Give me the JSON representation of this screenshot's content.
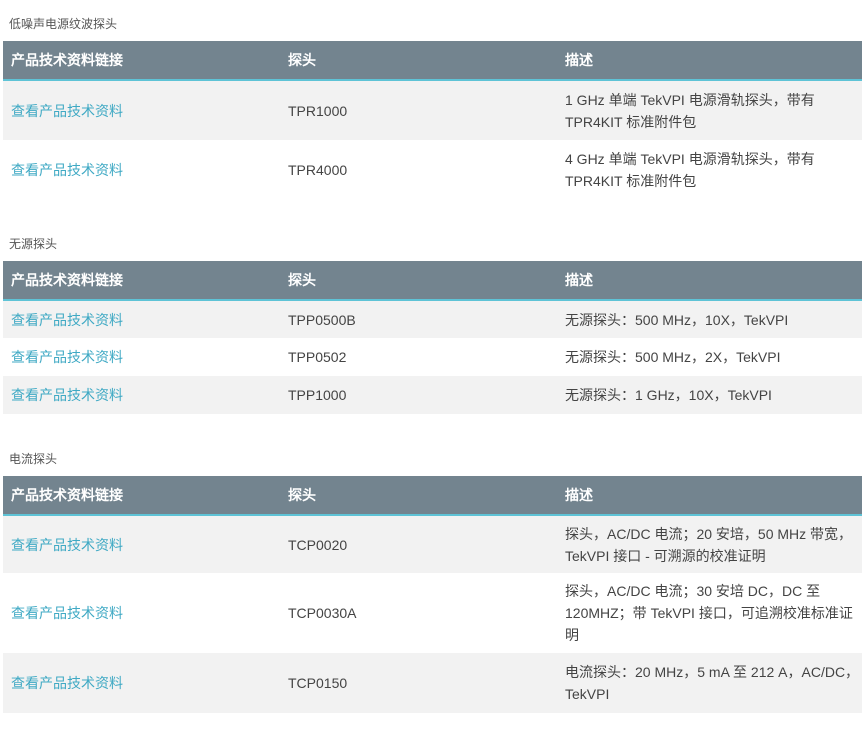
{
  "headers": {
    "link": "产品技术资料链接",
    "probe": "探头",
    "desc": "描述"
  },
  "sections": [
    {
      "title": "低噪声电源纹波探头",
      "rows": [
        {
          "link": "查看产品技术资料",
          "probe": "TPR1000",
          "desc": "1 GHz 单端 TekVPI 电源滑轨探头，带有 TPR4KIT 标准附件包"
        },
        {
          "link": "查看产品技术资料",
          "probe": "TPR4000",
          "desc": "4 GHz 单端 TekVPI 电源滑轨探头，带有 TPR4KIT 标准附件包"
        }
      ]
    },
    {
      "title": "无源探头",
      "rows": [
        {
          "link": "查看产品技术资料",
          "probe": "TPP0500B",
          "desc": "无源探头：500 MHz，10X，TekVPI"
        },
        {
          "link": "查看产品技术资料",
          "probe": "TPP0502",
          "desc": "无源探头：500 MHz，2X，TekVPI"
        },
        {
          "link": "查看产品技术资料",
          "probe": "TPP1000",
          "desc": "无源探头：1 GHz，10X，TekVPI"
        }
      ]
    },
    {
      "title": "电流探头",
      "rows": [
        {
          "link": "查看产品技术资料",
          "probe": "TCP0020",
          "desc": "探头，AC/DC 电流；20 安培，50 MHz 带宽，TekVPI 接口 - 可溯源的校准证明"
        },
        {
          "link": "查看产品技术资料",
          "probe": "TCP0030A",
          "desc": "探头，AC/DC 电流；30 安培 DC，DC 至 120MHZ；带 TekVPI 接口，可追溯校准标准证明"
        },
        {
          "link": "查看产品技术资料",
          "probe": "TCP0150",
          "desc": "电流探头：20 MHz，5 mA 至 212 A，AC/DC，TekVPI"
        }
      ]
    }
  ]
}
